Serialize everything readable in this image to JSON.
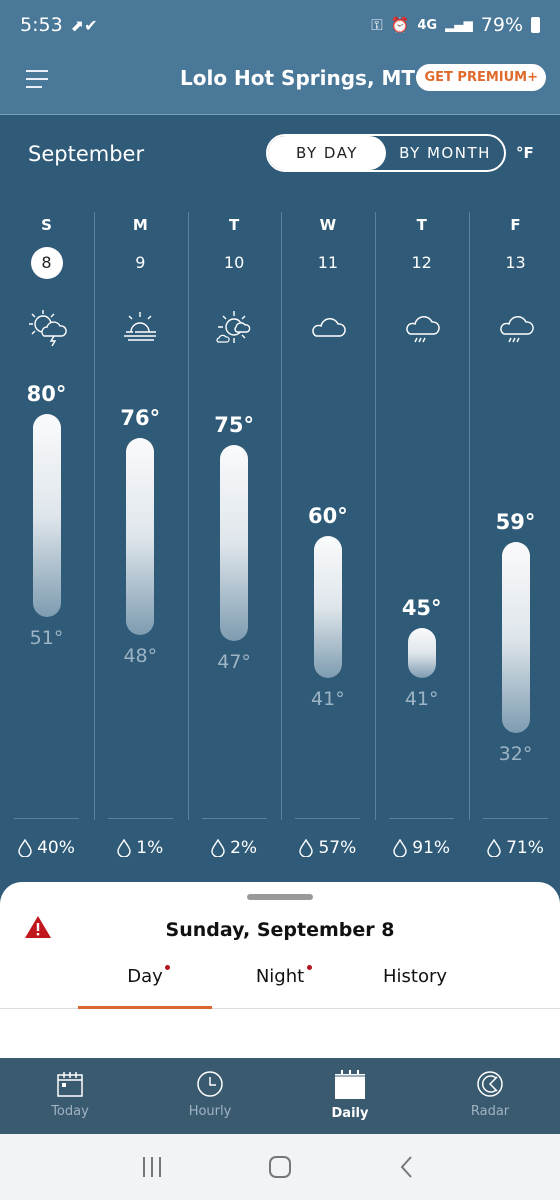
{
  "status": {
    "time": "5:53",
    "network": "4G",
    "battery": "79%"
  },
  "header": {
    "location": "Lolo Hot Springs, MT",
    "premium_label": "GET PREMIUM+"
  },
  "controls": {
    "month": "September",
    "by_day": "BY DAY",
    "by_month": "BY MONTH",
    "unit": "°F",
    "selected": "BY DAY"
  },
  "days": [
    {
      "dow": "S",
      "date": "8",
      "icon": "partly-sunny-thunderstorm-icon",
      "high": 80,
      "low": 51,
      "high_label": "80°",
      "low_label": "51°",
      "precip": "40%",
      "selected": true
    },
    {
      "dow": "M",
      "date": "9",
      "icon": "sunny-hazy-icon",
      "high": 76,
      "low": 48,
      "high_label": "76°",
      "low_label": "48°",
      "precip": "1%"
    },
    {
      "dow": "T",
      "date": "10",
      "icon": "partly-cloudy-icon",
      "high": 75,
      "low": 47,
      "high_label": "75°",
      "low_label": "47°",
      "precip": "2%"
    },
    {
      "dow": "W",
      "date": "11",
      "icon": "cloud-icon",
      "high": 60,
      "low": 41,
      "high_label": "60°",
      "low_label": "41°",
      "precip": "57%"
    },
    {
      "dow": "T",
      "date": "12",
      "icon": "rain-icon",
      "high": 45,
      "low": 41,
      "high_label": "45°",
      "low_label": "41°",
      "precip": "91%"
    },
    {
      "dow": "F",
      "date": "13",
      "icon": "rain-icon",
      "high": 59,
      "low": 32,
      "high_label": "59°",
      "low_label": "32°",
      "precip": "71%"
    }
  ],
  "sheet": {
    "title": "Sunday, September 8",
    "tabs": [
      {
        "label": "Day",
        "dot": true
      },
      {
        "label": "Night",
        "dot": true
      },
      {
        "label": "History",
        "dot": false
      }
    ],
    "active_tab": "Day",
    "alert_color": "#c0161c"
  },
  "nav": {
    "items": [
      {
        "label": "Today",
        "icon": "calendar-today-icon"
      },
      {
        "label": "Hourly",
        "icon": "clock-icon"
      },
      {
        "label": "Daily",
        "icon": "calendar-icon",
        "active": true
      },
      {
        "label": "Radar",
        "icon": "radar-icon"
      }
    ]
  },
  "colors": {
    "header": "#4a7898",
    "background": "#2f5a78",
    "accent": "#d9672f"
  }
}
